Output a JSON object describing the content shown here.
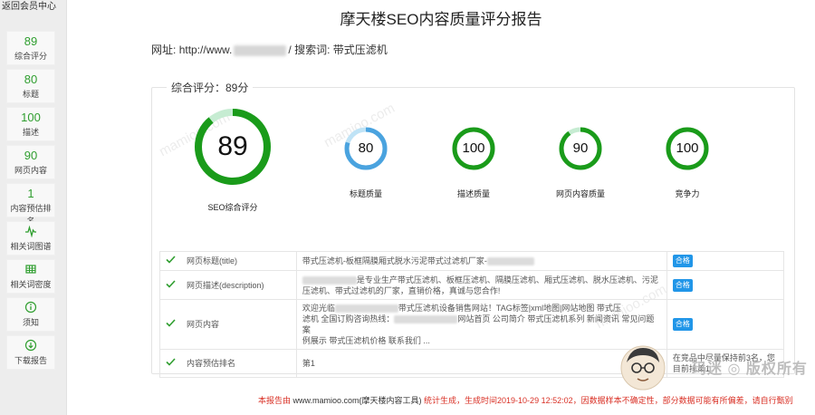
{
  "sidebar": {
    "back_label": "返回会员中心",
    "cards": [
      {
        "value": "89",
        "label": "综合评分"
      },
      {
        "value": "80",
        "label": "标题"
      },
      {
        "value": "100",
        "label": "描述"
      },
      {
        "value": "90",
        "label": "网页内容"
      },
      {
        "value": "1",
        "label": "内容预估排名"
      }
    ],
    "tools": [
      {
        "icon": "pulse-icon",
        "label": "相关词图谱"
      },
      {
        "icon": "table-icon",
        "label": "相关词密度"
      },
      {
        "icon": "info-circle-icon",
        "label": "须知"
      },
      {
        "icon": "download-icon",
        "label": "下载报告"
      }
    ]
  },
  "report": {
    "title": "摩天楼SEO内容质量评分报告",
    "url_label": "网址:",
    "url_prefix": "http://www.",
    "url_suffix": "/",
    "keyword_label": "搜索词:",
    "keyword": "带式压滤机",
    "overall_legend": "综合评分：89分"
  },
  "gauges": [
    {
      "value": 89,
      "label": "SEO综合评分",
      "color": "#1a9b1a"
    },
    {
      "value": 80,
      "label": "标题质量",
      "color": "#4aa3df"
    },
    {
      "value": 100,
      "label": "描述质量",
      "color": "#1a9b1a"
    },
    {
      "value": 90,
      "label": "网页内容质量",
      "color": "#1a9b1a"
    },
    {
      "value": 100,
      "label": "竞争力",
      "color": "#1a9b1a"
    }
  ],
  "items": [
    {
      "name": "网页标题(title)",
      "content": "带式压滤机-板框隔膜厢式脱水污泥带式过滤机厂家-",
      "status": "合格"
    },
    {
      "name": "网页描述(description)",
      "content_a": "是专业生产带式压滤机、板框压滤机、隔膜压滤机、厢式压滤机、脱水压滤机、污泥",
      "content_b": "压滤机、带式过滤机的厂家，直销价格，真诚与您合作!",
      "status": "合格"
    },
    {
      "name": "网页内容",
      "content_a": "欢迎光临",
      "content_b": "带式压滤机设备销售网站！TAG标签|xml地图|网站地图 带式压",
      "content_c": "滤机 全国订购咨询热线：",
      "content_d": "网站首页 公司简介 带式压滤机系列 新闻资讯 常见问题 案",
      "content_e": "例展示 带式压滤机价格 联系我们 ...",
      "status": "合格"
    },
    {
      "name": "内容预估排名",
      "content": "第1",
      "status": "在竞品中尽量保持前3名，您目前排第1"
    }
  ],
  "footer": {
    "prefix": "本报告由 ",
    "site": "www.mamioo.com(摩天楼内容工具)",
    "suffix": " 统计生成，生成时间2019-10-29 12:52:02，因数据样本不确定性，部分数据可能有所偏差，请自行甄别"
  },
  "watermarks": [
    "mamioo.com",
    "mamioo.com",
    "mamioo.com"
  ],
  "brand_mark": "玛迷 ◎ 版权所有",
  "colors": {
    "green": "#1a9b1a",
    "blue": "#4aa3df",
    "track": "#c6ecd2",
    "pass_badge": "#2196e8",
    "footer_red": "#d93025"
  }
}
